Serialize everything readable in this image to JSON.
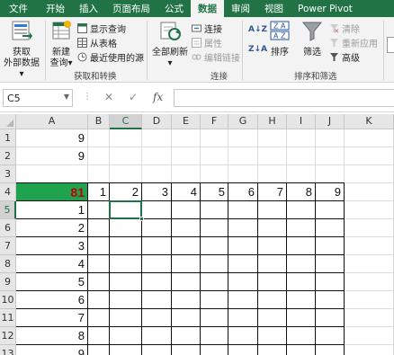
{
  "ribbon_tabs": [
    "文件",
    "开始",
    "插入",
    "页面布局",
    "公式",
    "数据",
    "审阅",
    "视图",
    "Power Pivot"
  ],
  "active_tab": "数据",
  "groups": {
    "get_transform": {
      "label": "获取和转换",
      "get_external_data": [
        "获取",
        "外部数据▾"
      ],
      "new_query": [
        "新建",
        "查询▾"
      ],
      "show_queries": "显示查询",
      "from_table": "从表格",
      "recent_sources": "最近使用的源"
    },
    "connections": {
      "label": "连接",
      "refresh_all": [
        "全部刷新",
        "▾"
      ],
      "connections": "连接",
      "properties": "属性",
      "edit_links": "编辑链接"
    },
    "sort_filter": {
      "label": "排序和筛选",
      "sort_az": "A↓Z",
      "sort_za": "Z↓A",
      "sort": "排序",
      "filter": "筛选",
      "clear": "清除",
      "reapply": "重新应用",
      "advanced": "高级"
    }
  },
  "formula_bar": {
    "name_box": "C5",
    "cancel": "✕",
    "enter": "✓",
    "fx": "fx",
    "formula": ""
  },
  "columns": [
    "A",
    "B",
    "C",
    "D",
    "E",
    "F",
    "G",
    "H",
    "I",
    "J",
    "K"
  ],
  "rows": [
    "1",
    "2",
    "3",
    "4",
    "5",
    "6",
    "7",
    "8",
    "9",
    "10",
    "11",
    "12",
    "13"
  ],
  "cells": {
    "A1": "9",
    "A2": "9",
    "A4": "81",
    "B4": "1",
    "C4": "2",
    "D4": "3",
    "E4": "4",
    "F4": "5",
    "G4": "6",
    "H4": "7",
    "I4": "8",
    "J4": "9",
    "A5": "1",
    "A6": "2",
    "A7": "3",
    "A8": "4",
    "A9": "5",
    "A10": "6",
    "A11": "7",
    "A12": "8",
    "A13": "9"
  },
  "active_cell": "C5",
  "colors": {
    "excel_green": "#217346",
    "highlight_fill": "#1fa34f",
    "highlight_text": "#c00000"
  }
}
